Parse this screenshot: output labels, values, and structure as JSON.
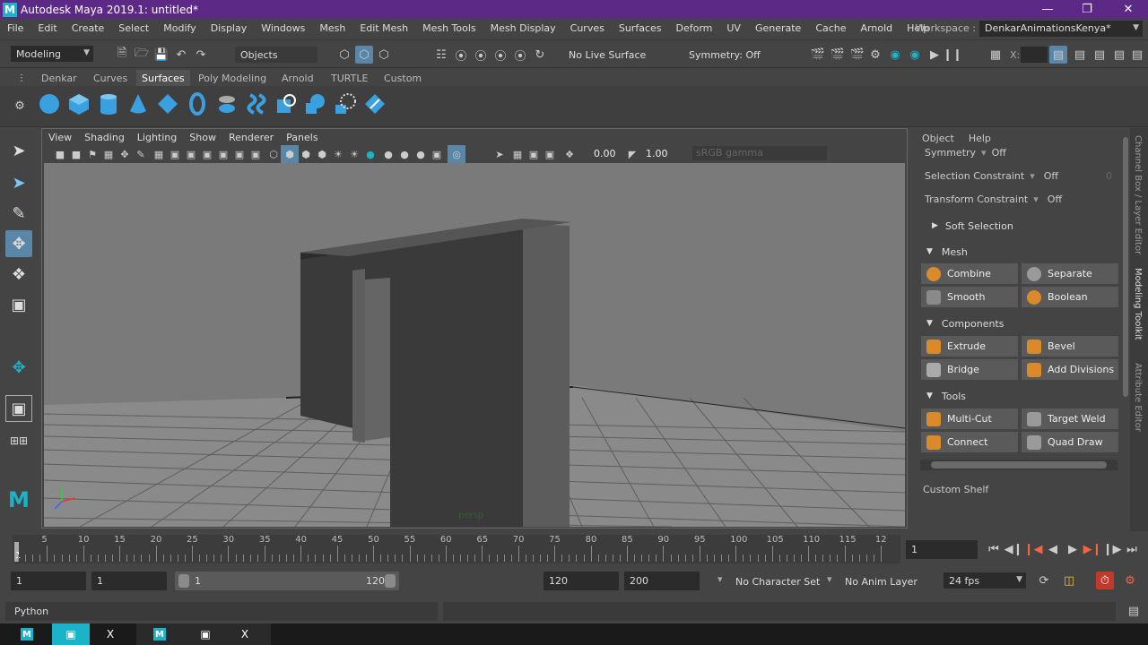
{
  "app": {
    "title": "Autodesk Maya 2019.1: untitled*",
    "logo_letter": "M"
  },
  "menus": [
    "File",
    "Edit",
    "Create",
    "Select",
    "Modify",
    "Display",
    "Windows",
    "Mesh",
    "Edit Mesh",
    "Mesh Tools",
    "Mesh Display",
    "Curves",
    "Surfaces",
    "Deform",
    "UV",
    "Generate",
    "Cache",
    "Arnold",
    "Help"
  ],
  "workspace": {
    "label": "Workspace :",
    "value": "DenkarAnimationsKenya*"
  },
  "statusline": {
    "mode": "Modeling",
    "select_mode": "Objects",
    "live_surface": "No Live Surface",
    "symmetry": "Symmetry: Off",
    "x_label": "X:"
  },
  "shelf": {
    "tabs": [
      "Denkar",
      "Curves",
      "Surfaces",
      "Poly Modeling",
      "Arnold",
      "TURTLE",
      "Custom"
    ],
    "active_tab": "Surfaces"
  },
  "panel": {
    "menus": [
      "View",
      "Shading",
      "Lighting",
      "Show",
      "Renderer",
      "Panels"
    ],
    "exposure": "0.00",
    "gamma": "1.00",
    "colorspace": "sRGB gamma",
    "camera_label": "persp"
  },
  "rightpanel": {
    "menus": [
      "Object",
      "Help"
    ],
    "symmetry_label": "Symmetry",
    "symmetry_value": "Off",
    "sel_constraint_label": "Selection Constraint",
    "sel_constraint_value": "Off",
    "sel_constraint_num": "0",
    "transform_constraint_label": "Transform Constraint",
    "transform_constraint_value": "Off",
    "soft_selection": "Soft Selection",
    "sections": {
      "mesh": "Mesh",
      "components": "Components",
      "tools": "Tools"
    },
    "buttons": {
      "combine": "Combine",
      "separate": "Separate",
      "smooth": "Smooth",
      "boolean": "Boolean",
      "extrude": "Extrude",
      "bevel": "Bevel",
      "bridge": "Bridge",
      "add_divisions": "Add Divisions",
      "multi_cut": "Multi-Cut",
      "target_weld": "Target Weld",
      "connect": "Connect",
      "quad_draw": "Quad Draw"
    },
    "custom_shelf": "Custom Shelf"
  },
  "sidetabs": [
    "Channel Box / Layer Editor",
    "Modeling Toolkit",
    "Attribute Editor"
  ],
  "timeline": {
    "ticks": [
      "5",
      "10",
      "15",
      "20",
      "25",
      "30",
      "35",
      "40",
      "45",
      "50",
      "55",
      "60",
      "65",
      "70",
      "75",
      "80",
      "85",
      "90",
      "95",
      "100",
      "105",
      "110",
      "115",
      "12"
    ],
    "current_marker": "1",
    "current_frame": "1"
  },
  "range": {
    "start": "1",
    "start_inner": "1",
    "slider_start": "1",
    "slider_end": "120",
    "end_inner": "120",
    "end": "200",
    "character_set": "No Character Set",
    "anim_layer": "No Anim Layer",
    "fps": "24 fps"
  },
  "cmd": {
    "language": "Python"
  },
  "taskbar": {
    "icon_close": "X"
  },
  "colors": {
    "titlebar": "#5c2a86",
    "accent_cyan": "#1bb3c7",
    "shelf_blue": "#3aa0e0",
    "button_orange": "#d98a2b"
  }
}
